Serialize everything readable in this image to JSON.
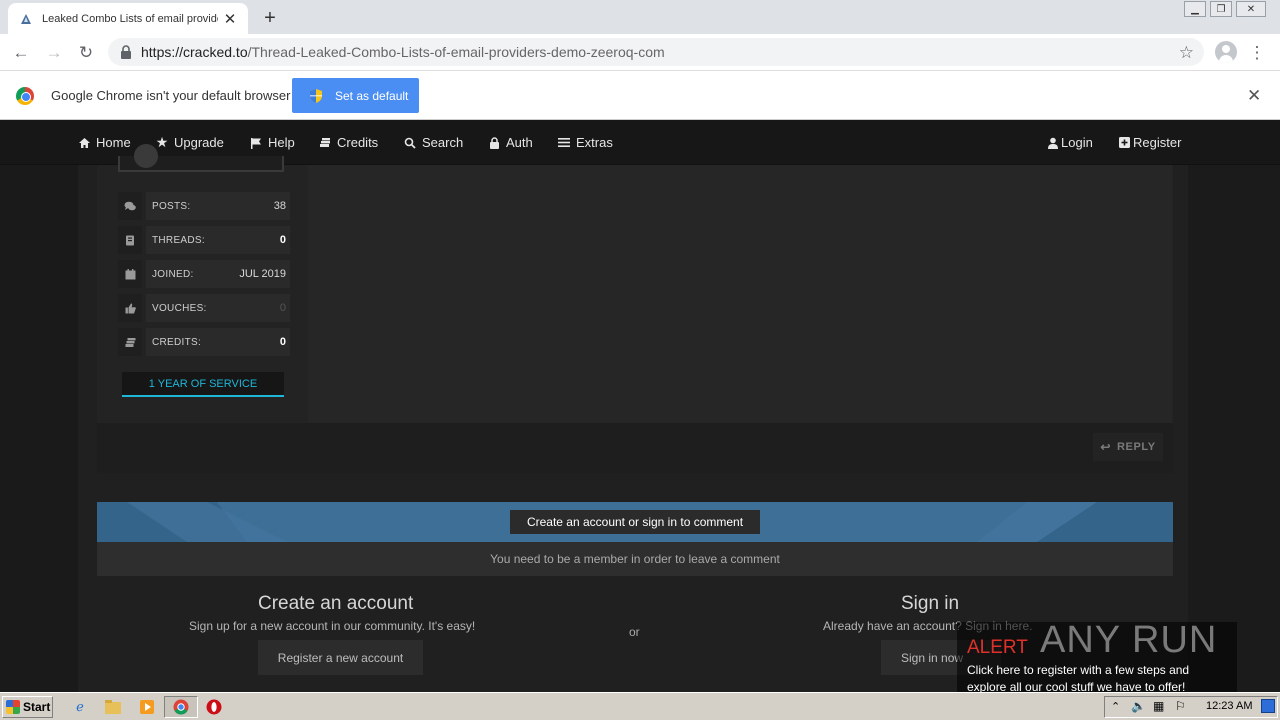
{
  "browser": {
    "tab_title": "Leaked Combo Lists of email providers demo zeeroq com",
    "url_host": "https://cracked.to",
    "url_path": "/Thread-Leaked-Combo-Lists-of-email-providers-demo-zeeroq-com"
  },
  "infobar": {
    "message": "Google Chrome isn't your default browser",
    "button_label": "Set as default"
  },
  "nav": {
    "items": [
      {
        "label": "Home",
        "icon": "home-icon"
      },
      {
        "label": "Upgrade",
        "icon": "star-icon"
      },
      {
        "label": "Help",
        "icon": "flag-icon"
      },
      {
        "label": "Credits",
        "icon": "credits-icon"
      },
      {
        "label": "Search",
        "icon": "search-icon"
      },
      {
        "label": "Auth",
        "icon": "lock-icon"
      },
      {
        "label": "Extras",
        "icon": "bars-icon"
      }
    ],
    "login": "Login",
    "register": "Register"
  },
  "profile_stats": [
    {
      "label": "POSTS:",
      "value": "38"
    },
    {
      "label": "THREADS:",
      "value": "0"
    },
    {
      "label": "JOINED:",
      "value": "JUL 2019"
    },
    {
      "label": "VOUCHES:",
      "value": "0"
    },
    {
      "label": "CREDITS:",
      "value": "0"
    }
  ],
  "service_badge": "1 YEAR OF SERVICE",
  "reply_label": "REPLY",
  "comment_section": {
    "title": "Create an account or sign in to comment",
    "subtitle": "You need to be a member in order to leave a comment",
    "create": {
      "title": "Create an account",
      "text": "Sign up for a new account in our community. It's easy!",
      "button": "Register a new account"
    },
    "or": "or",
    "signin": {
      "title": "Sign in",
      "text": "Already have an account? Sign in here.",
      "button": "Sign in now"
    }
  },
  "watermark": {
    "alert": "ALERT",
    "text": "Click here to register with a few steps and explore all our cool stuff we have to offer!",
    "brand": "ANY RUN"
  },
  "taskbar": {
    "start": "Start",
    "clock": "12:23 AM"
  },
  "colors": {
    "accent": "#1fb6d8",
    "banner": "#3e6f97",
    "chrome_button": "#4b8ef3"
  }
}
